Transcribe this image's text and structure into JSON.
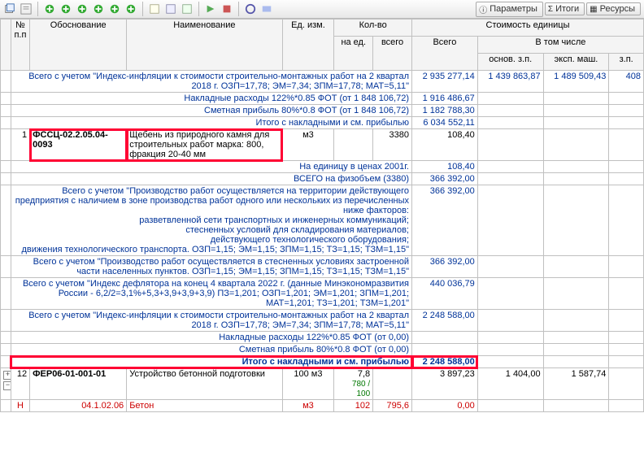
{
  "tabs": {
    "params": "Параметры",
    "itogi": "Итоги",
    "resursy": "Ресурсы"
  },
  "headers": {
    "npp": "№ п.п",
    "obosn": "Обоснование",
    "naim": "Наименование",
    "edizm": "Ед. изм.",
    "kolvo": "Кол-во",
    "naed": "на ед.",
    "vsego": "всего",
    "vsego_cost": "Всего",
    "stoim_ed": "Стоимость единицы",
    "vtomchisle": "В том числе",
    "osn": "основ. з.п.",
    "eksp": "эксп. маш.",
    "zp": "з.п."
  },
  "rows": [
    {
      "type": "sum",
      "text": "Всего с учетом \"Индекс-инфляции к стоимости строительно-монтажных работ на 2 квартал 2018 г. ОЗП=17,78; ЭМ=7,34; ЗПМ=17,78; МАТ=5,11\"",
      "vsego": "2 935 277,14",
      "osn": "1 439 863,87",
      "eksp": "1 489 509,43",
      "zp": "408"
    },
    {
      "type": "sum",
      "text": "Накладные расходы 122%*0.85 ФОТ (от 1 848 106,72)",
      "vsego": "1 916 486,67"
    },
    {
      "type": "sum",
      "text": "Сметная прибыль 80%*0.8 ФОТ (от 1 848 106,72)",
      "vsego": "1 182 788,30"
    },
    {
      "type": "sum",
      "text": "Итого с накладными и см. прибылью",
      "vsego": "6 034 552,11"
    },
    {
      "type": "item",
      "npp": "1",
      "code": "ФССЦ-02.2.05.04-0093",
      "name": "Щебень из природного камня для строительных работ марка: 800, фракция 20-40 мм",
      "edizm": "м3",
      "kolvo_vsego": "3380",
      "cost_vsego": "108,40",
      "red": true
    },
    {
      "type": "sum",
      "text": "На единицу в ценах 2001г.",
      "vsego": "108,40"
    },
    {
      "type": "sum",
      "text": "ВСЕГО на физобъем (3380)",
      "vsego": "366 392,00"
    },
    {
      "type": "sum",
      "text": "Всего с учетом \"Производство работ осуществляется на территории действующего предприятия с наличием в зоне производства работ одного или нескольких из перечисленных ниже факторов:\nразветвленной сети транспортных и инженерных коммуникаций;\nстесненных условий для складирования материалов;\nдействующего технологического оборудования;\nдвижения технологического транспорта. ОЗП=1,15; ЭМ=1,15; ЗПМ=1,15; ТЗ=1,15; ТЗМ=1,15\"",
      "vsego": "366 392,00"
    },
    {
      "type": "sum",
      "text": "Всего с учетом \"Производство работ осуществляется в стесненных условиях застроенной части населенных пунктов. ОЗП=1,15; ЭМ=1,15; ЗПМ=1,15; ТЗ=1,15; ТЗМ=1,15\"",
      "vsego": "366 392,00"
    },
    {
      "type": "sum",
      "text": "Всего с учетом \"Индекс дефлятора на конец 4 квартала 2022 г. (данные Минэкономразвития России - 6,2/2=3,1%+5,3+3,9+3,9+3,9) ПЗ=1,201; ОЗП=1,201; ЭМ=1,201; ЗПМ=1,201; МАТ=1,201; ТЗ=1,201; ТЗМ=1,201\"",
      "vsego": "440 036,79"
    },
    {
      "type": "sum",
      "text": "Всего с учетом \"Индекс-инфляции к стоимости строительно-монтажных работ на 2 квартал 2018 г. ОЗП=17,78; ЭМ=7,34; ЗПМ=17,78; МАТ=5,11\"",
      "vsego": "2 248 588,00"
    },
    {
      "type": "sum",
      "text": "Накладные расходы 122%*0.85 ФОТ (от 0,00)"
    },
    {
      "type": "sum",
      "text": "Сметная прибыль 80%*0.8 ФОТ (от 0,00)"
    },
    {
      "type": "sum",
      "text": "Итого с накладными и см. прибылью",
      "vsego": "2 248 588,00",
      "boxed": true
    },
    {
      "type": "item",
      "npp": "12",
      "code": "ФЕР06-01-001-01",
      "name": "Устройство бетонной подготовки",
      "edizm": "100 м3",
      "kolvo_naed": "7,8",
      "kolvo_mini": "780 / 100",
      "cost_vsego": "3 897,23",
      "osn": "1 404,00",
      "eksp": "1 587,74",
      "tree": true
    },
    {
      "type": "child",
      "letter": "Н",
      "code": "04.1.02.06",
      "name": "Бетон",
      "edizm": "м3",
      "kolvo_naed": "102",
      "kolvo_vsego": "795,6",
      "cost_vsego": "0,00"
    }
  ]
}
